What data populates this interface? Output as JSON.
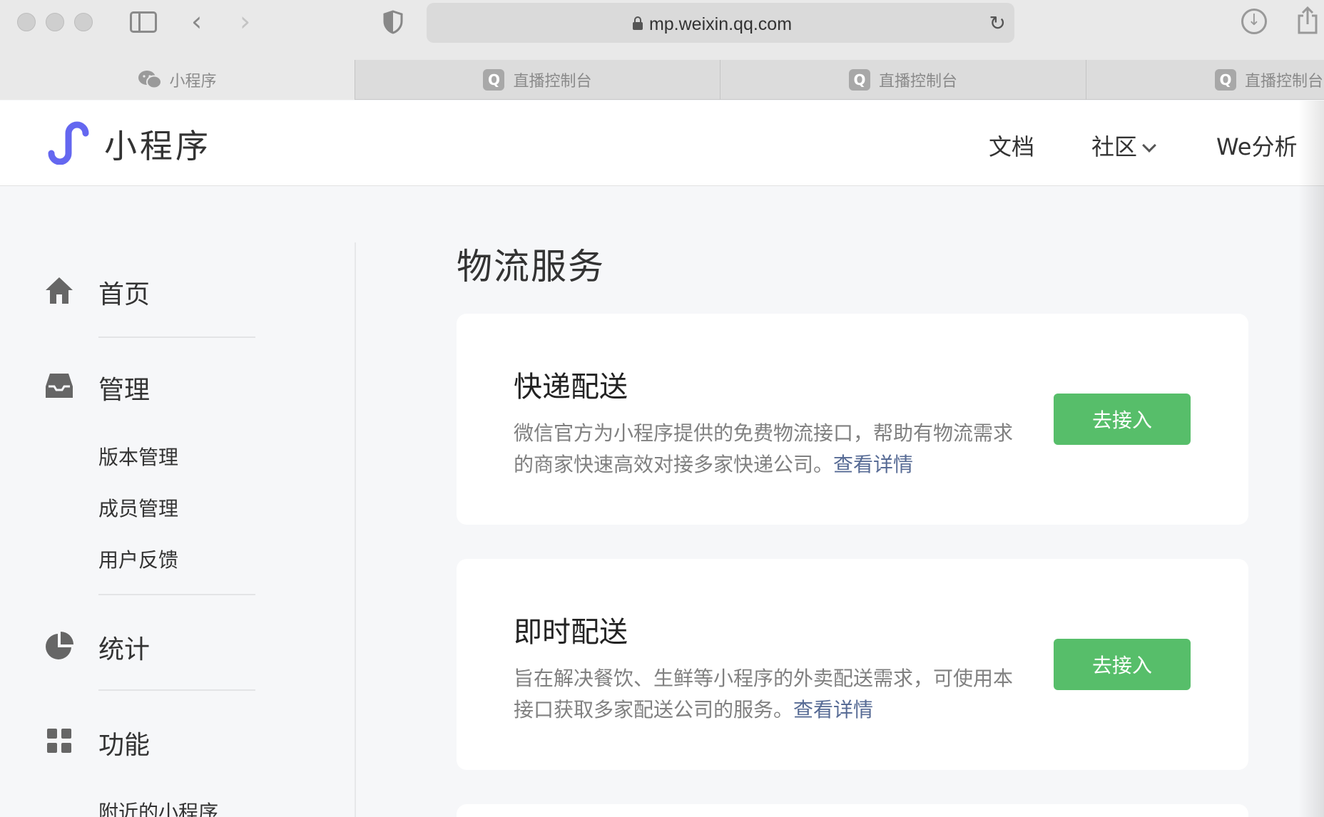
{
  "browser": {
    "url": "mp.weixin.qq.com",
    "tabs": [
      {
        "label": "小程序",
        "icon": "wechat-icon"
      },
      {
        "label": "直播控制台",
        "icon": "q-icon"
      },
      {
        "label": "直播控制台",
        "icon": "q-icon"
      },
      {
        "label": "直播控制台",
        "icon": "q-icon"
      }
    ],
    "tab_q": "Q"
  },
  "header": {
    "brand": "小程序",
    "nav": {
      "docs": "文档",
      "community": "社区",
      "we_analysis": "We分析"
    }
  },
  "sidebar": {
    "home": "首页",
    "manage": "管理",
    "manage_items": [
      "版本管理",
      "成员管理",
      "用户反馈"
    ],
    "stats": "统计",
    "features": "功能",
    "features_items": [
      "附近的小程序"
    ]
  },
  "main": {
    "title": "物流服务",
    "cards": [
      {
        "title": "快递配送",
        "desc": "微信官方为小程序提供的免费物流接口，帮助有物流需求的商家快速高效对接多家快递公司。",
        "link": "查看详情",
        "button": "去接入"
      },
      {
        "title": "即时配送",
        "desc": "旨在解决餐饮、生鲜等小程序的外卖配送需求，可使用本接口获取多家配送公司的服务。",
        "link": "查看详情",
        "button": "去接入"
      }
    ]
  },
  "colors": {
    "accent_green": "#57be6a",
    "link_blue": "#576b95",
    "logo_purple": "#6467f0"
  }
}
